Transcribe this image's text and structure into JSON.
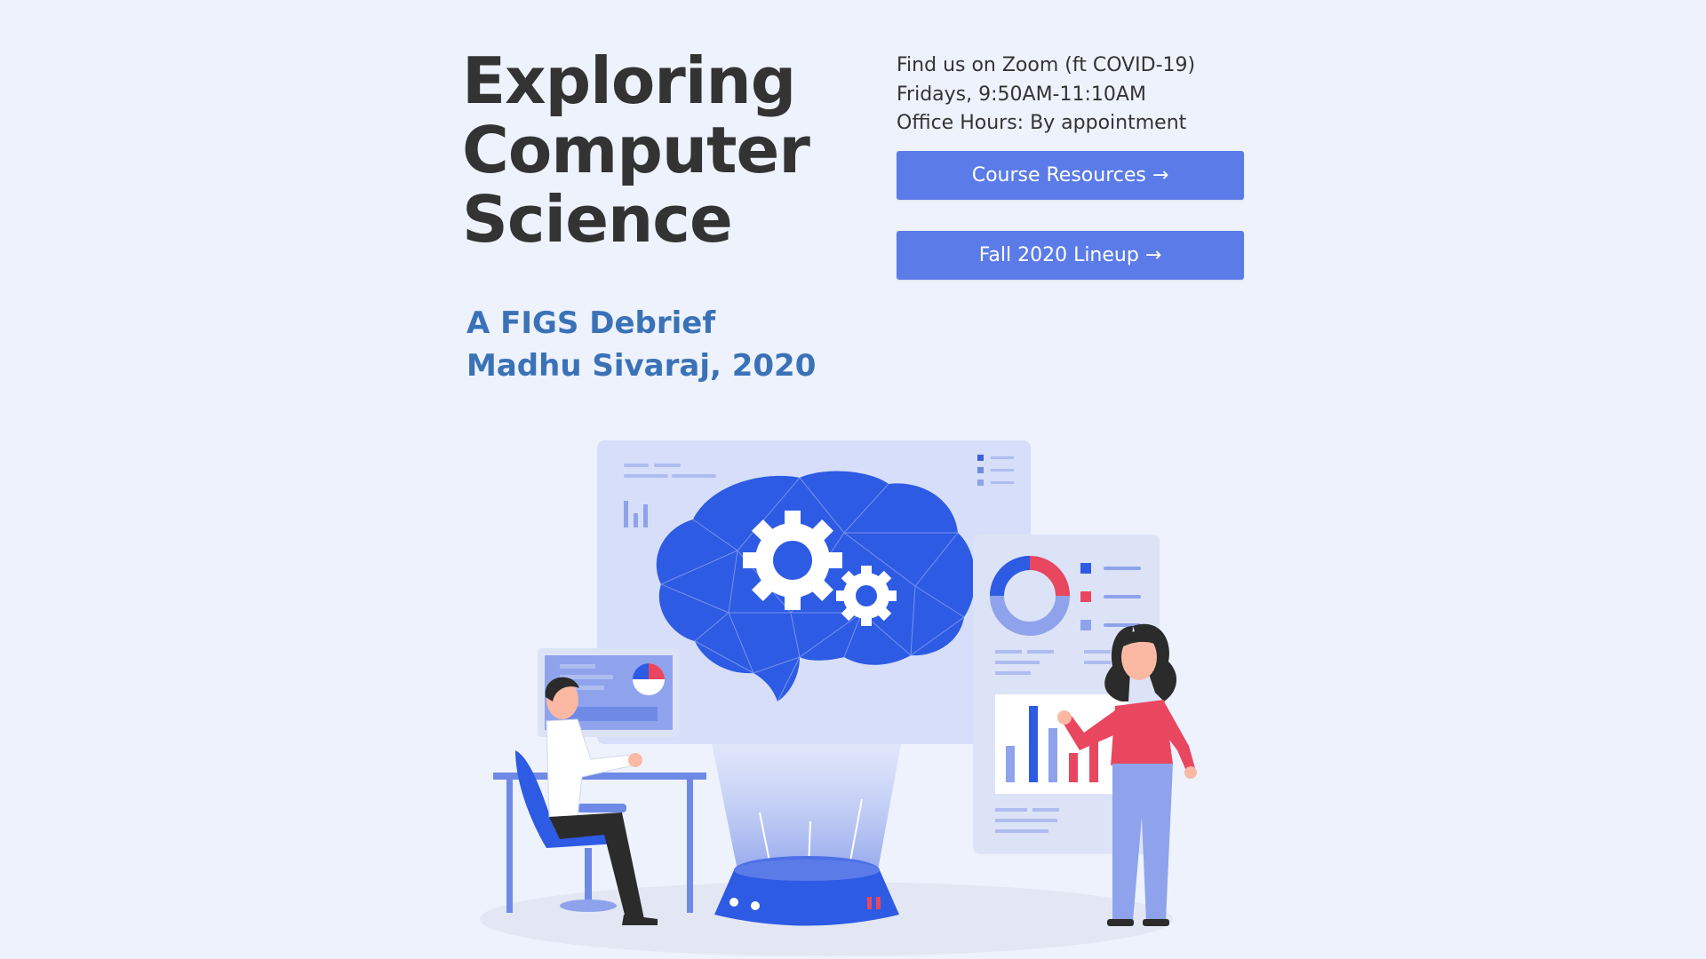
{
  "title": {
    "line1": "Exploring",
    "line2": "Computer",
    "line3": "Science"
  },
  "subtitle": {
    "line1": "A FIGS Debrief",
    "line2": "Madhu Sivaraj, 2020"
  },
  "info": {
    "line1": "Find us on Zoom (ft COVID-19)",
    "line2": "Fridays, 9:50AM-11:10AM",
    "line3": "Office Hours: By appointment"
  },
  "buttons": {
    "resources": "Course Resources →",
    "lineup": "Fall 2020 Lineup →"
  },
  "colors": {
    "background": "#eef2fc",
    "title": "#333333",
    "subtitle": "#3a72b8",
    "button": "#5b7be8",
    "illustration_primary": "#2d5be3",
    "illustration_accent": "#e8475f"
  },
  "illustration": {
    "icon": "ai-brain-team-illustration"
  }
}
